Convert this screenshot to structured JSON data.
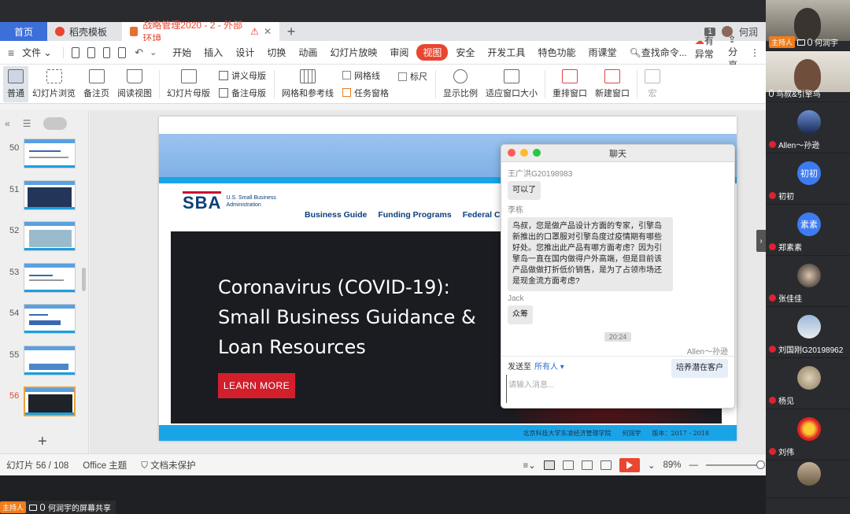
{
  "tabs": {
    "home": "首页",
    "doc1": "稻壳模板",
    "doc2": "战略管理2020 - 2 - 外部环境",
    "page_indicator": "1",
    "user_short": "何润"
  },
  "menu": {
    "file": "文件",
    "items": [
      "开始",
      "插入",
      "设计",
      "切换",
      "动画",
      "幻灯片放映",
      "审阅",
      "视图",
      "安全",
      "开发工具",
      "特色功能",
      "雨课堂"
    ],
    "active": "视图",
    "search": "查找命令...",
    "sync": "有异常",
    "share": "分享"
  },
  "ribbon": {
    "normal": "普通",
    "slide_browse": "幻灯片浏览",
    "notes_page": "备注页",
    "reading_view": "阅读视图",
    "slide_master": "幻灯片母版",
    "handout_master": "讲义母版",
    "notes_master": "备注母版",
    "grid_guides": "网格和参考线",
    "grid_lines": "网格线",
    "ruler": "标尺",
    "task_pane": "任务窗格",
    "show_ratio": "显示比例",
    "fit_window": "适应窗口大小",
    "rearrange": "重排窗口",
    "new_window": "新建窗口",
    "macro": "宏"
  },
  "thumbnails": [
    {
      "num": "50"
    },
    {
      "num": "51"
    },
    {
      "num": "52"
    },
    {
      "num": "53"
    },
    {
      "num": "54"
    },
    {
      "num": "55"
    },
    {
      "num": "56"
    }
  ],
  "current_slide": "56",
  "slide": {
    "sba_mark": "SBA",
    "sba_name": "U.S. Small Business Administration",
    "nav": [
      "Business Guide",
      "Funding Programs",
      "Federal Contra"
    ],
    "hero_line1": "Coronavirus (COVID-19):",
    "hero_line2": "Small Business Guidance &",
    "hero_line3": "Loan Resources",
    "button": "LEARN MORE",
    "footer_school": "北京科技大学东凌经济管理学院",
    "footer_name": "何润宇",
    "footer_year": "版本：2017 - 2018"
  },
  "status": {
    "slide_count": "幻灯片 56 / 108",
    "theme": "Office 主题",
    "protect": "文档未保护",
    "zoom": "89%"
  },
  "chat": {
    "title": "聊天",
    "messages": [
      {
        "name": "王广洪G20198983",
        "text": "可以了"
      },
      {
        "name": "李栋",
        "text": "鸟叔，您是做产品设计方面的专家，引擎岛新推出的口罩服对引擎岛度过疫情期有哪些好处。您推出此产品有哪方面考虑？因为引擎岛一直在国内做得户外高端，但是目前该产品做做打折低价销售，是为了占领市场还是现金流方面考虑?"
      },
      {
        "name": "Jack",
        "text": "众筹"
      }
    ],
    "time": "20:24",
    "self_name": "Allen～孙逊",
    "self_text": "培养潜在客户",
    "send_to": "发送至",
    "send_to_value": "所有人",
    "input_placeholder": "请输入消息..."
  },
  "participants": [
    {
      "name": "何润宇",
      "host": "主持人"
    },
    {
      "name": "鸟叔&引擎鸟"
    },
    {
      "name": "Allen～孙逊"
    },
    {
      "name": "初初",
      "avatar_text": "初初"
    },
    {
      "name": "郑素素",
      "avatar_text": "素素"
    },
    {
      "name": "张佳佳"
    },
    {
      "name": "刘国刚G20198962"
    },
    {
      "name": "杨见"
    },
    {
      "name": "刘伟"
    }
  ],
  "sharebar": {
    "host": "主持人",
    "text": "何润宇的屏幕共享"
  },
  "colors": {
    "accent": "#e8462f",
    "home_tab": "#3d6fd9",
    "sba_blue": "#0b3f7a",
    "sba_red": "#d21f2b",
    "host_orange": "#f07d1a"
  }
}
